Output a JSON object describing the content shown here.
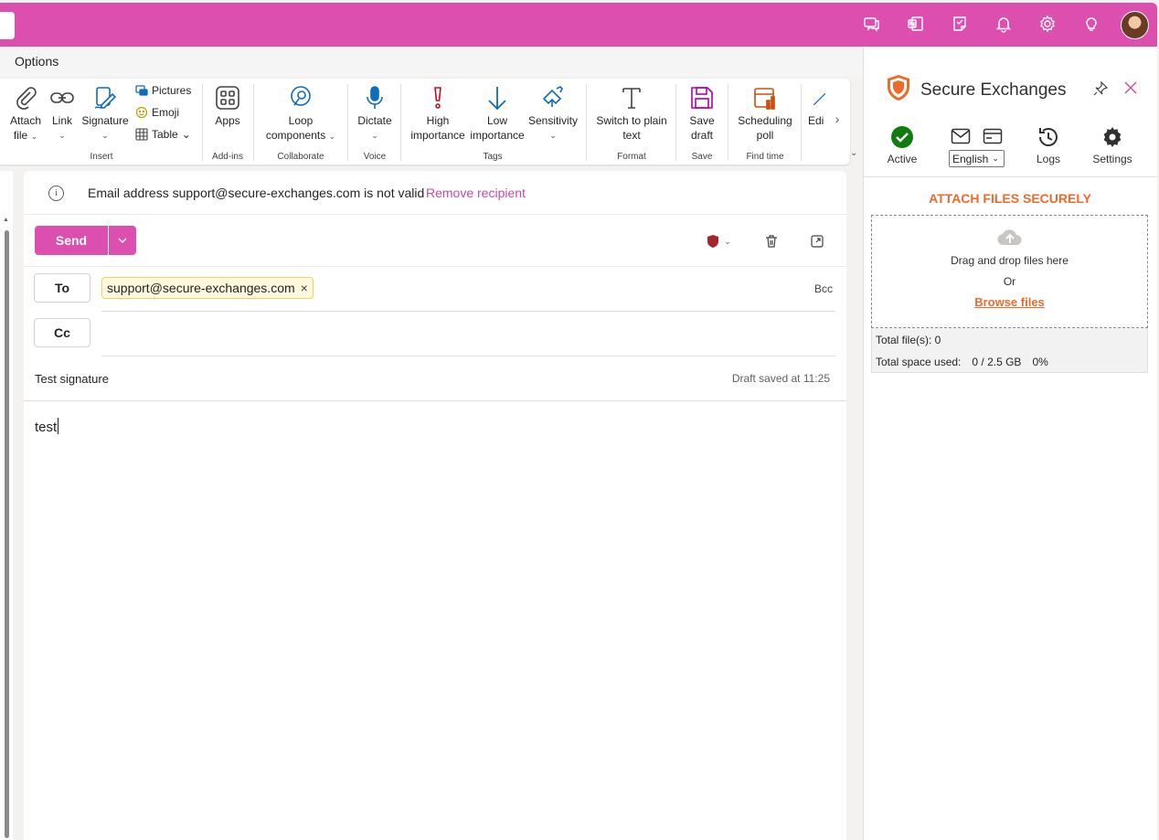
{
  "tabs": {
    "options": "Options"
  },
  "ribbon": {
    "attach": "Attach\nfile",
    "attach_l1": "Attach",
    "attach_l2": "file",
    "link": "Link",
    "signature": "Signature",
    "pictures": "Pictures",
    "emoji": "Emoji",
    "table": "Table",
    "apps": "Apps",
    "loop_l1": "Loop",
    "loop_l2": "components",
    "dictate": "Dictate",
    "high_l1": "High",
    "high_l2": "importance",
    "low_l1": "Low",
    "low_l2": "importance",
    "sensitivity": "Sensitivity",
    "switch_l1": "Switch to plain",
    "switch_l2": "text",
    "save_l1": "Save",
    "save_l2": "draft",
    "sched_l1": "Scheduling",
    "sched_l2": "poll",
    "edit_l1": "Edi",
    "groups": {
      "insert": "Insert",
      "addins": "Add-ins",
      "collaborate": "Collaborate",
      "voice": "Voice",
      "tags": "Tags",
      "format": "Format",
      "save": "Save",
      "findtime": "Find time"
    }
  },
  "compose": {
    "warning_text": "Email address support@secure-exchanges.com is not valid",
    "warning_link": "Remove recipient",
    "send": "Send",
    "to_label": "To",
    "cc_label": "Cc",
    "bcc": "Bcc",
    "to_recipient": "support@secure-exchanges.com",
    "signature": "Test signature",
    "draft_saved": "Draft saved at 11:25",
    "body": "test"
  },
  "pane": {
    "title": "Secure Exchanges",
    "active": "Active",
    "language": "English",
    "logs": "Logs",
    "settings": "Settings",
    "attach_title": "ATTACH FILES SECURELY",
    "drop_text": "Drag and drop files here",
    "or": "Or",
    "browse": "Browse files",
    "total_files": "Total file(s): 0",
    "total_space_label": "Total space used:",
    "total_space_value": "0 / 2.5 GB",
    "total_space_pct": "0%"
  },
  "colors": {
    "brand": "#dd4faf",
    "accent_orange": "#ed6a2d",
    "active_green": "#107c10",
    "warning_link": "#c74aa6"
  },
  "icons": {
    "topbar": [
      "chat-icon",
      "onenote-icon",
      "tasks-icon",
      "bell-icon",
      "gear-icon",
      "lightbulb-icon"
    ]
  }
}
